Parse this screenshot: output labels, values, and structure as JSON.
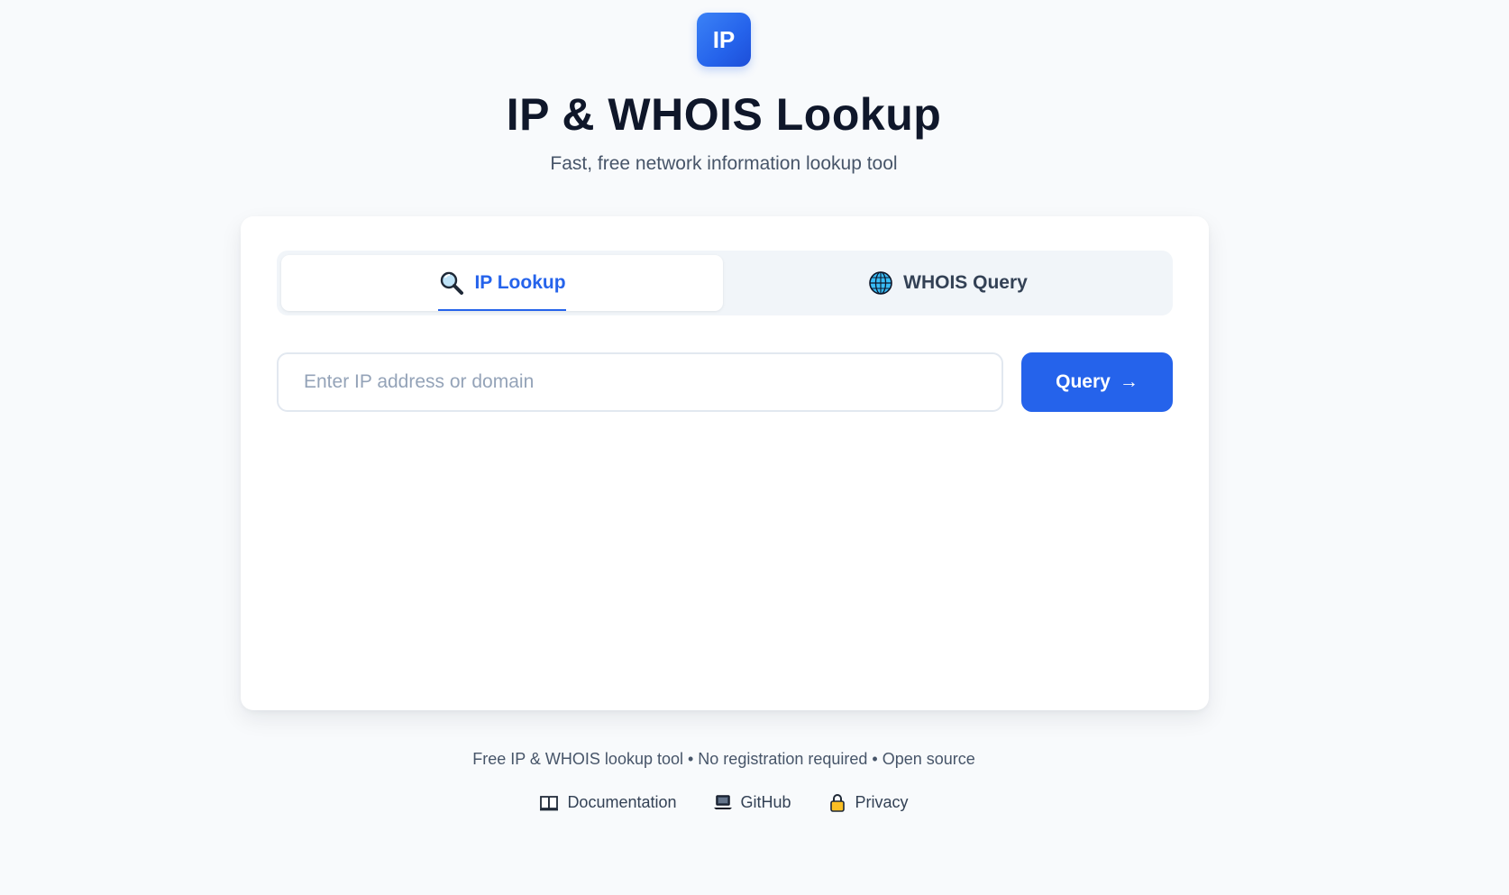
{
  "brand": {
    "logo_text": "IP",
    "title": "IP & WHOIS Lookup",
    "subtitle": "Fast, free network information lookup tool",
    "accent_color": "#2563eb"
  },
  "tabs": [
    {
      "label": "IP Lookup",
      "icon": "magnifier-icon",
      "active": true
    },
    {
      "label": "WHOIS Query",
      "icon": "globe-icon",
      "active": false
    }
  ],
  "search": {
    "value": "",
    "placeholder": "Enter IP address or domain"
  },
  "query_button": {
    "label": "Query",
    "arrow": "→"
  },
  "footer": {
    "text": "Free IP & WHOIS lookup tool • No registration required • Open source",
    "links": [
      {
        "label": "Documentation",
        "icon": "book-icon"
      },
      {
        "label": "GitHub",
        "icon": "laptop-icon"
      },
      {
        "label": "Privacy",
        "icon": "lock-icon"
      }
    ]
  }
}
